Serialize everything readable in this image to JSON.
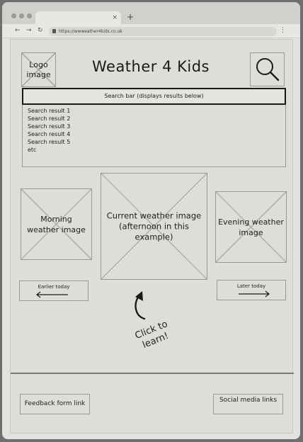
{
  "browser": {
    "tab_close": "×",
    "new_tab": "+",
    "url": "https://wwweather4kids.co.uk",
    "nav_back": "←",
    "nav_forward": "→",
    "nav_reload": "↻",
    "menu": "⋮"
  },
  "header": {
    "logo_label": "Logo image",
    "title": "Weather 4 Kids",
    "search_icon": "magnifier-icon"
  },
  "search": {
    "bar_label": "Search bar (displays results below)",
    "results": [
      "Search result 1",
      "Search result 2",
      "Search result 3",
      "Search result 4",
      "Search result 5",
      "etc"
    ]
  },
  "weather": {
    "morning_label": "Morning weather image",
    "current_label": "Current weather image (afternoon in this example)",
    "evening_label": "Evening weather image",
    "earlier_label": "Earlier today",
    "later_label": "Later today",
    "click_hint": "Click to learn!"
  },
  "footer": {
    "feedback_label": "Feedback form link",
    "social_label": "Social media links"
  },
  "colors": {
    "page_bg": "#dfddd8",
    "placeholder_line": "#9a9895",
    "ink": "#1a1a1a"
  }
}
